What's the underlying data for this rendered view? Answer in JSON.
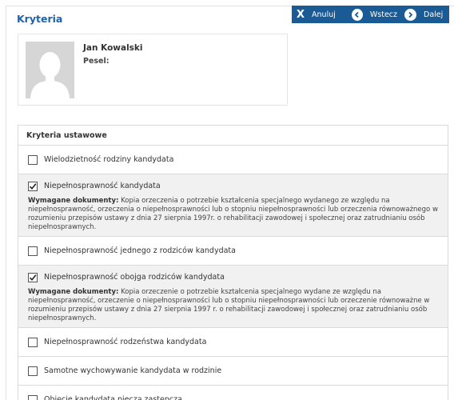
{
  "page": {
    "title": "Kryteria"
  },
  "toolbar": {
    "cancel_label": "Anuluj",
    "back_label": "Wstecz",
    "next_label": "Dalej"
  },
  "profile": {
    "name": "Jan Kowalski",
    "pesel_label": "Pesel:"
  },
  "criteria": {
    "header": "Kryteria ustawowe",
    "docs_label": "Wymagane dokumenty:",
    "items": [
      {
        "label": "Wielodzietność rodziny kandydata",
        "checked": false,
        "docs": ""
      },
      {
        "label": "Niepełnosprawność kandydata",
        "checked": true,
        "docs": "Kopia orzeczenia o potrzebie kształcenia specjalnego wydanego ze względu na niepełnosprawność, orzeczenia o niepełnosprawności lub o stopniu niepełnosprawności lub orzeczenia równoważnego w rozumieniu przepisów ustawy z dnia 27 sierpnia 1997r. o rehabilitacji zawodowej i społecznej oraz zatrudnianiu osób niepełnosprawnych."
      },
      {
        "label": "Niepełnosprawność jednego z rodziców kandydata",
        "checked": false,
        "docs": ""
      },
      {
        "label": "Niepełnosprawność obojga rodziców kandydata",
        "checked": true,
        "docs": "Kopia orzeczenie o potrzebie kształcenia specjalnego wydane ze względu na niepełnosprawność, orzeczenie o niepełnosprawności lub o stopniu niepełnosprawności lub orzeczenie równoważne w rozumieniu przepisów ustawy z dnia 27 sierpnia 1997 r. o rehabilitacji zawodowej i społecznej oraz zatrudnianiu osób niepełnosprawnych."
      },
      {
        "label": "Niepełnosprawność rodzeństwa kandydata",
        "checked": false,
        "docs": ""
      },
      {
        "label": "Samotne wychowywanie kandydata w rodzinie",
        "checked": false,
        "docs": ""
      },
      {
        "label": "Objęcie kandydata pieczą zastępczą",
        "checked": false,
        "docs": ""
      }
    ]
  },
  "colors": {
    "accent": "#1a5b96",
    "title": "#1e63a8",
    "checked_row_bg": "#f1f1f1"
  },
  "icons": {
    "cancel": "close-icon",
    "back": "circle-arrow-left-icon",
    "next": "circle-arrow-right-icon",
    "avatar": "user-silhouette-icon",
    "checkbox_checked": "checkmark-icon"
  }
}
